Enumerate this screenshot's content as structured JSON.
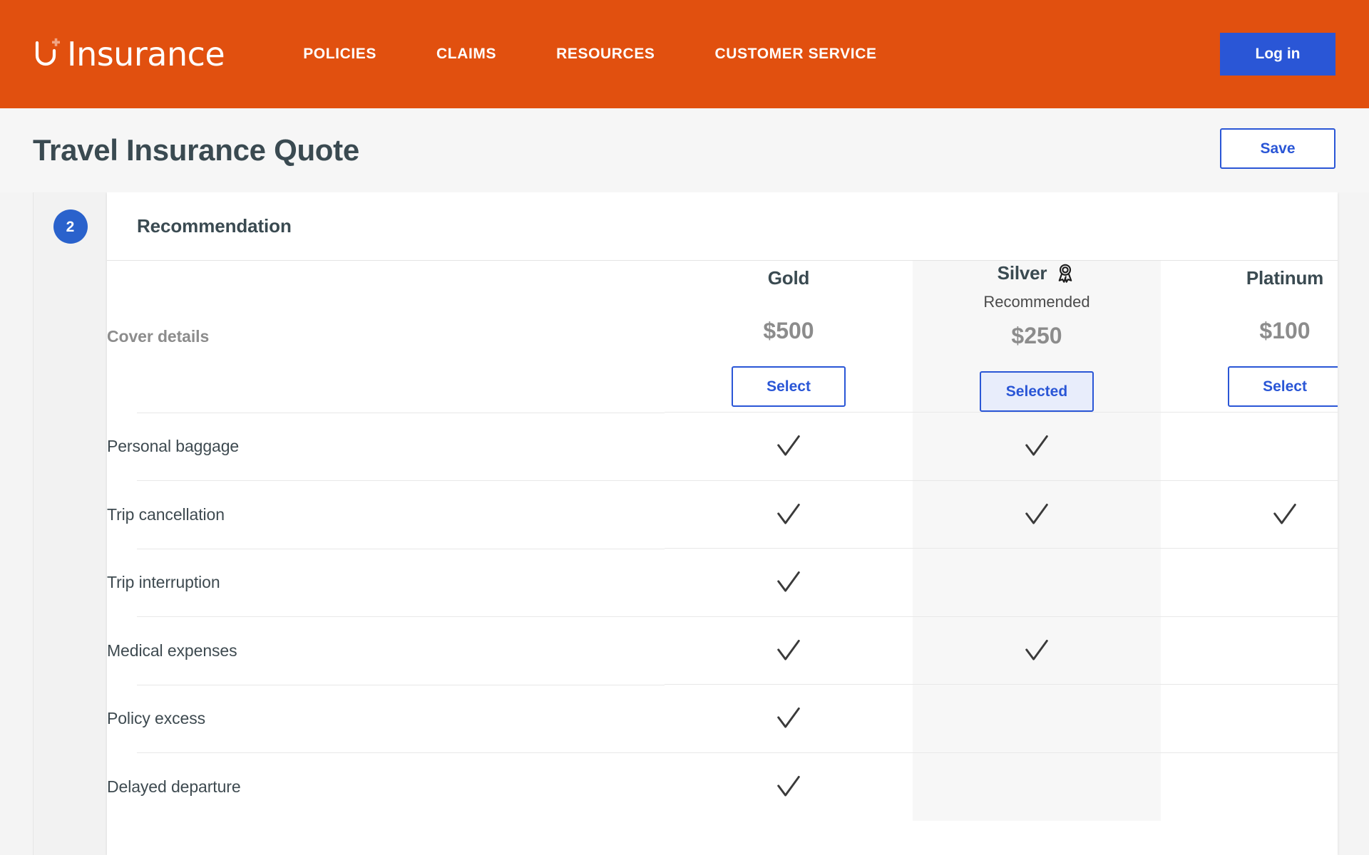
{
  "brand": {
    "name": "Insurance",
    "logo_icon": "u-plus-logo-icon"
  },
  "nav": {
    "items": [
      {
        "label": "POLICIES"
      },
      {
        "label": "CLAIMS"
      },
      {
        "label": "RESOURCES"
      },
      {
        "label": "CUSTOMER SERVICE"
      }
    ],
    "login_label": "Log in"
  },
  "page": {
    "title": "Travel Insurance Quote",
    "save_label": "Save"
  },
  "step": {
    "number": "2",
    "title": "Recommendation"
  },
  "table": {
    "cover_details_label": "Cover details",
    "plans": [
      {
        "name": "Gold",
        "subtitle": "",
        "price": "$500",
        "button_label": "Select",
        "selected": false,
        "recommended": false,
        "badge_icon": ""
      },
      {
        "name": "Silver",
        "subtitle": "Recommended",
        "price": "$250",
        "button_label": "Selected",
        "selected": true,
        "recommended": true,
        "badge_icon": "rosette-award-icon"
      },
      {
        "name": "Platinum",
        "subtitle": "",
        "price": "$100",
        "button_label": "Select",
        "selected": false,
        "recommended": false,
        "badge_icon": ""
      }
    ],
    "features": [
      {
        "label": "Personal baggage",
        "gold": true,
        "silver": true,
        "platinum": false
      },
      {
        "label": "Trip cancellation",
        "gold": true,
        "silver": true,
        "platinum": true
      },
      {
        "label": "Trip interruption",
        "gold": true,
        "silver": false,
        "platinum": false
      },
      {
        "label": "Medical expenses",
        "gold": true,
        "silver": true,
        "platinum": false
      },
      {
        "label": "Policy excess",
        "gold": true,
        "silver": false,
        "platinum": false
      },
      {
        "label": "Delayed departure",
        "gold": true,
        "silver": false,
        "platinum": false
      }
    ],
    "check_icon": "checkmark-icon"
  },
  "colors": {
    "brand_orange": "#e1500f",
    "accent_blue": "#2a56d6",
    "step_badge_blue": "#2a62cc",
    "selected_fill": "#e8edfb",
    "price_gray": "#8c8c8c",
    "heading_slate": "#3a4a51",
    "highlight_column": "#f7f7f7",
    "page_bg": "#f4f4f4"
  }
}
